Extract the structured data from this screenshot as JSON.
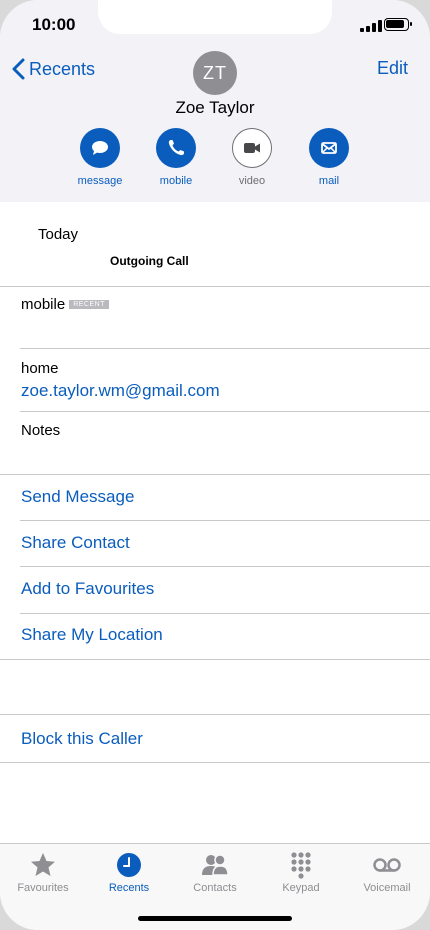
{
  "status": {
    "time": "10:00"
  },
  "nav": {
    "back_label": "Recents",
    "edit_label": "Edit"
  },
  "contact": {
    "initials": "ZT",
    "name": "Zoe Taylor"
  },
  "actions": [
    {
      "label": "message",
      "icon": "message-bubble-icon"
    },
    {
      "label": "mobile",
      "icon": "phone-icon"
    },
    {
      "label": "video",
      "icon": "video-camera-icon"
    },
    {
      "label": "mail",
      "icon": "envelope-icon"
    }
  ],
  "recent": {
    "day": "Today",
    "call_type": "Outgoing Call"
  },
  "fields": {
    "mobile_label": "mobile",
    "mobile_badge": "RECENT",
    "home_label": "home",
    "home_email": "zoe.taylor.wm@gmail.com",
    "notes_label": "Notes"
  },
  "links": {
    "send_message": "Send Message",
    "share_contact": "Share Contact",
    "add_favourites": "Add to Favourites",
    "share_location": "Share My Location",
    "block_caller": "Block this Caller"
  },
  "tabs": [
    {
      "label": "Favourites",
      "active": false
    },
    {
      "label": "Recents",
      "active": true
    },
    {
      "label": "Contacts",
      "active": false
    },
    {
      "label": "Keypad",
      "active": false
    },
    {
      "label": "Voicemail",
      "active": false
    }
  ],
  "colors": {
    "accent": "#0a5dbd",
    "header_bg": "#f2f2f7",
    "inactive": "#8e8e93"
  }
}
